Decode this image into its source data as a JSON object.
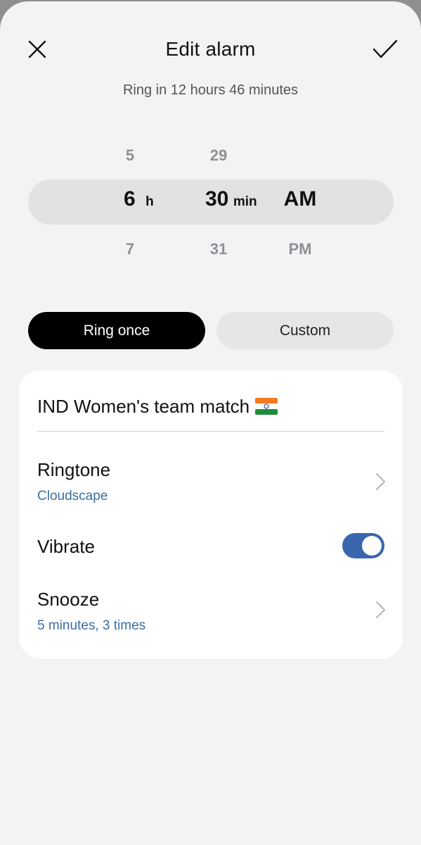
{
  "header": {
    "title": "Edit alarm",
    "subtitle": "Ring in 12 hours 46 minutes",
    "close_icon": "close-icon",
    "confirm_icon": "checkmark-icon"
  },
  "picker": {
    "hour": {
      "prev": "5",
      "selected": "6",
      "next": "7",
      "unit": "h"
    },
    "minute": {
      "prev": "29",
      "selected": "30",
      "next": "31",
      "unit": "min"
    },
    "ampm": {
      "selected": "AM",
      "next": "PM"
    }
  },
  "repeat": {
    "ring_once_label": "Ring once",
    "custom_label": "Custom",
    "selected": "Ring once"
  },
  "settings": {
    "alarm_name": "IND Women's team match",
    "alarm_name_emoji": "flag-india-icon",
    "ringtone": {
      "label": "Ringtone",
      "value": "Cloudscape"
    },
    "vibrate": {
      "label": "Vibrate",
      "enabled": true
    },
    "snooze": {
      "label": "Snooze",
      "value": "5 minutes, 3 times"
    }
  },
  "colors": {
    "accent": "#3a66ad",
    "link_text": "#3a6ea5",
    "background": "#f2f3f5",
    "selected_segment": "#000000"
  }
}
